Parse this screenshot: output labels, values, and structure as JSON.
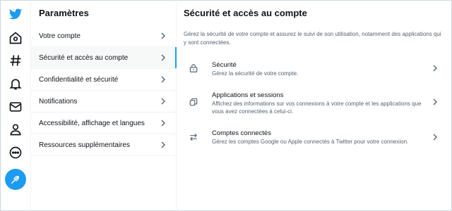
{
  "settings": {
    "title": "Paramètres",
    "items": [
      {
        "label": "Votre compte"
      },
      {
        "label": "Sécurité et accès au compte"
      },
      {
        "label": "Confidentialité et sécurité"
      },
      {
        "label": "Notifications"
      },
      {
        "label": "Accessibilité, affichage et langues"
      },
      {
        "label": "Ressources supplémentaires"
      }
    ]
  },
  "detail": {
    "title": "Sécurité et accès au compte",
    "description": "Gérez la sécurité de votre compte et assurez le suivi de son utilisation, notamment des applications qui y sont connectées.",
    "options": [
      {
        "title": "Sécurité",
        "desc": "Gérez la sécurité de votre compte.",
        "icon": "lock-icon"
      },
      {
        "title": "Applications et sessions",
        "desc": "Affichez des informations sur vos connexions à votre compte et les applications que vous avez connectées à celui-ci.",
        "icon": "devices-icon"
      },
      {
        "title": "Comptes connectés",
        "desc": "Gérez les comptes Google ou Apple connectés à Twitter pour votre connexion.",
        "icon": "swap-arrows-icon"
      }
    ]
  },
  "colors": {
    "accent": "#1d9bf0",
    "text": "#0f1419",
    "muted": "#536471"
  }
}
